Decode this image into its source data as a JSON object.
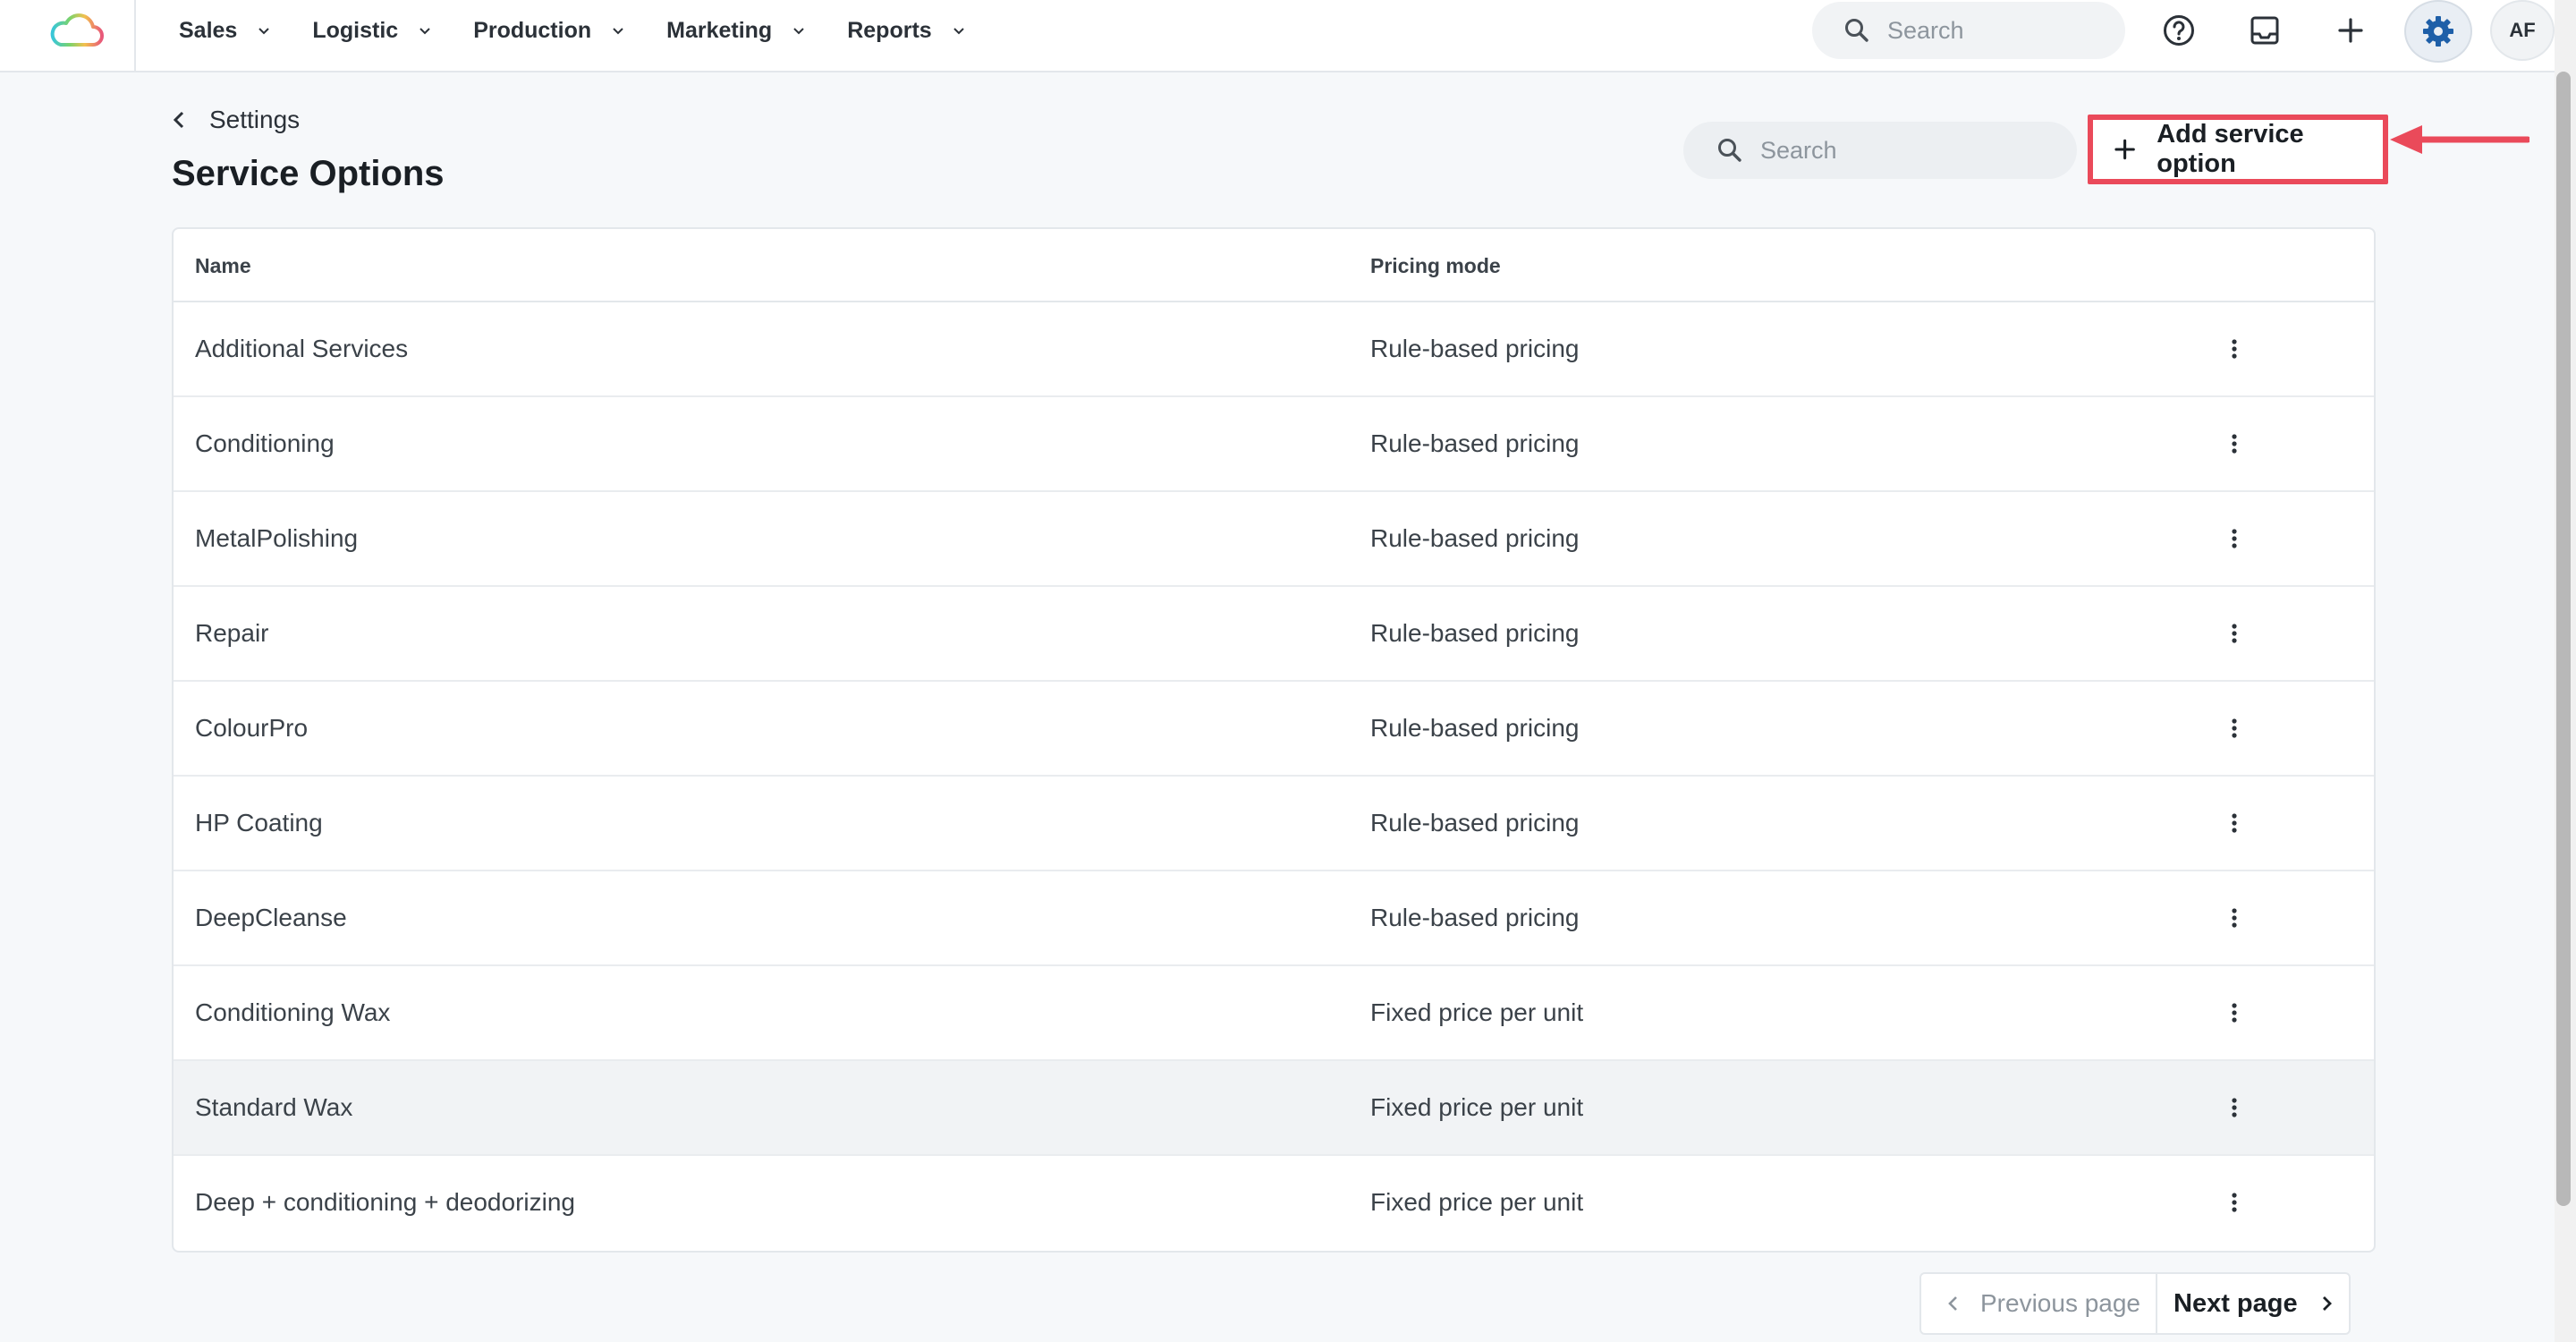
{
  "nav": {
    "items": [
      {
        "label": "Sales"
      },
      {
        "label": "Logistic"
      },
      {
        "label": "Production"
      },
      {
        "label": "Marketing"
      },
      {
        "label": "Reports"
      }
    ],
    "search_placeholder": "Search",
    "avatar_initials": "AF",
    "icons": {
      "logo": "cloud-logo-icon",
      "help": "help-circle-icon",
      "inbox": "inbox-icon",
      "add": "plus-icon",
      "settings": "gear-icon"
    }
  },
  "breadcrumb": {
    "label": "Settings"
  },
  "page": {
    "title": "Service Options",
    "search_placeholder": "Search",
    "add_button_label": "Add service option"
  },
  "table": {
    "columns": [
      "Name",
      "Pricing mode"
    ],
    "rows": [
      {
        "name": "Additional Services",
        "pricing_mode": "Rule-based pricing"
      },
      {
        "name": "Conditioning",
        "pricing_mode": "Rule-based pricing"
      },
      {
        "name": "MetalPolishing",
        "pricing_mode": "Rule-based pricing"
      },
      {
        "name": "Repair",
        "pricing_mode": "Rule-based pricing"
      },
      {
        "name": "ColourPro",
        "pricing_mode": "Rule-based pricing"
      },
      {
        "name": "HP Coating",
        "pricing_mode": "Rule-based pricing"
      },
      {
        "name": "DeepCleanse",
        "pricing_mode": "Rule-based pricing"
      },
      {
        "name": "Conditioning Wax",
        "pricing_mode": "Fixed price per unit"
      },
      {
        "name": "Standard Wax",
        "pricing_mode": "Fixed price per unit"
      },
      {
        "name": "Deep + conditioning + deodorizing",
        "pricing_mode": "Fixed price per unit"
      }
    ],
    "highlighted_row_index": 8
  },
  "pagination": {
    "previous_label": "Previous page",
    "next_label": "Next page"
  },
  "colors": {
    "annotation_red": "#ea4a5a",
    "background": "#f6f8fa",
    "settings_active": "#1e5fa8"
  }
}
